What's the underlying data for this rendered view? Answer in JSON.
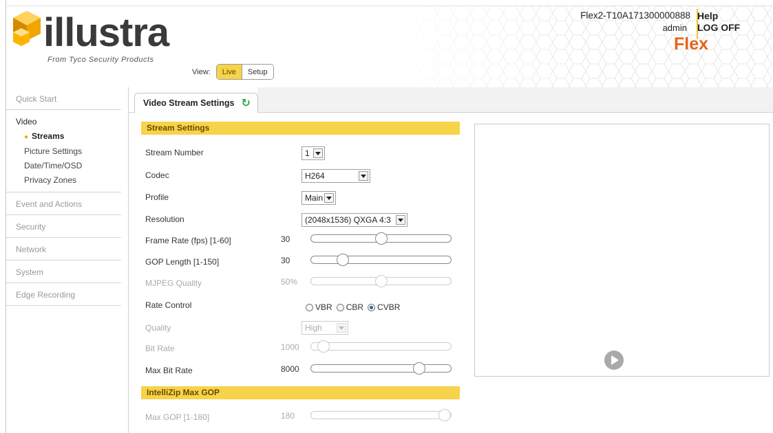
{
  "header": {
    "logo_name": "illustra",
    "logo_sub": "From Tyco Security Products",
    "device_id": "Flex2-T10A171300000888",
    "user": "admin",
    "help": "Help",
    "logoff": "LOG OFF",
    "product_badge": "Flex",
    "view_label": "View:",
    "view_live": "Live",
    "view_setup": "Setup"
  },
  "sidebar": {
    "quick_start": "Quick Start",
    "video": "Video",
    "video_items": [
      "Streams",
      "Picture Settings",
      "Date/Time/OSD",
      "Privacy Zones"
    ],
    "event_actions": "Event and Actions",
    "security": "Security",
    "network": "Network",
    "system": "System",
    "edge_recording": "Edge Recording"
  },
  "tab": {
    "title": "Video Stream Settings"
  },
  "stream_settings": {
    "section_title": "Stream Settings",
    "stream_number_label": "Stream Number",
    "stream_number": "1",
    "codec_label": "Codec",
    "codec": "H264",
    "profile_label": "Profile",
    "profile": "Main",
    "resolution_label": "Resolution",
    "resolution": "(2048x1536) QXGA 4:3",
    "frame_rate_label": "Frame Rate (fps) [1-60]",
    "frame_rate": "30",
    "frame_rate_level": 0.5,
    "gop_label": "GOP Length [1-150]",
    "gop": "30",
    "gop_level": 0.2,
    "mjpeg_label": "MJPEG Quality",
    "mjpeg": "50%",
    "mjpeg_level": 0.5,
    "rate_control_label": "Rate Control",
    "rate_options": [
      "VBR",
      "CBR",
      "CVBR"
    ],
    "rate_selected": "CVBR",
    "quality_label": "Quality",
    "quality": "High",
    "bit_rate_label": "Bit Rate",
    "bit_rate": "1000",
    "bit_rate_level": 0.05,
    "max_bit_rate_label": "Max Bit Rate",
    "max_bit_rate": "8000",
    "max_bit_rate_level": 0.8
  },
  "intellizip": {
    "section_title": "IntelliZip Max GOP",
    "max_gop_label": "Max GOP [1-180]",
    "max_gop": "180",
    "max_gop_level": 1.0
  },
  "colors": {
    "accent": "#f7d34a",
    "brand_orange": "#f0a500",
    "flex_orange": "#e8621a",
    "refresh": "#2ea84a"
  }
}
